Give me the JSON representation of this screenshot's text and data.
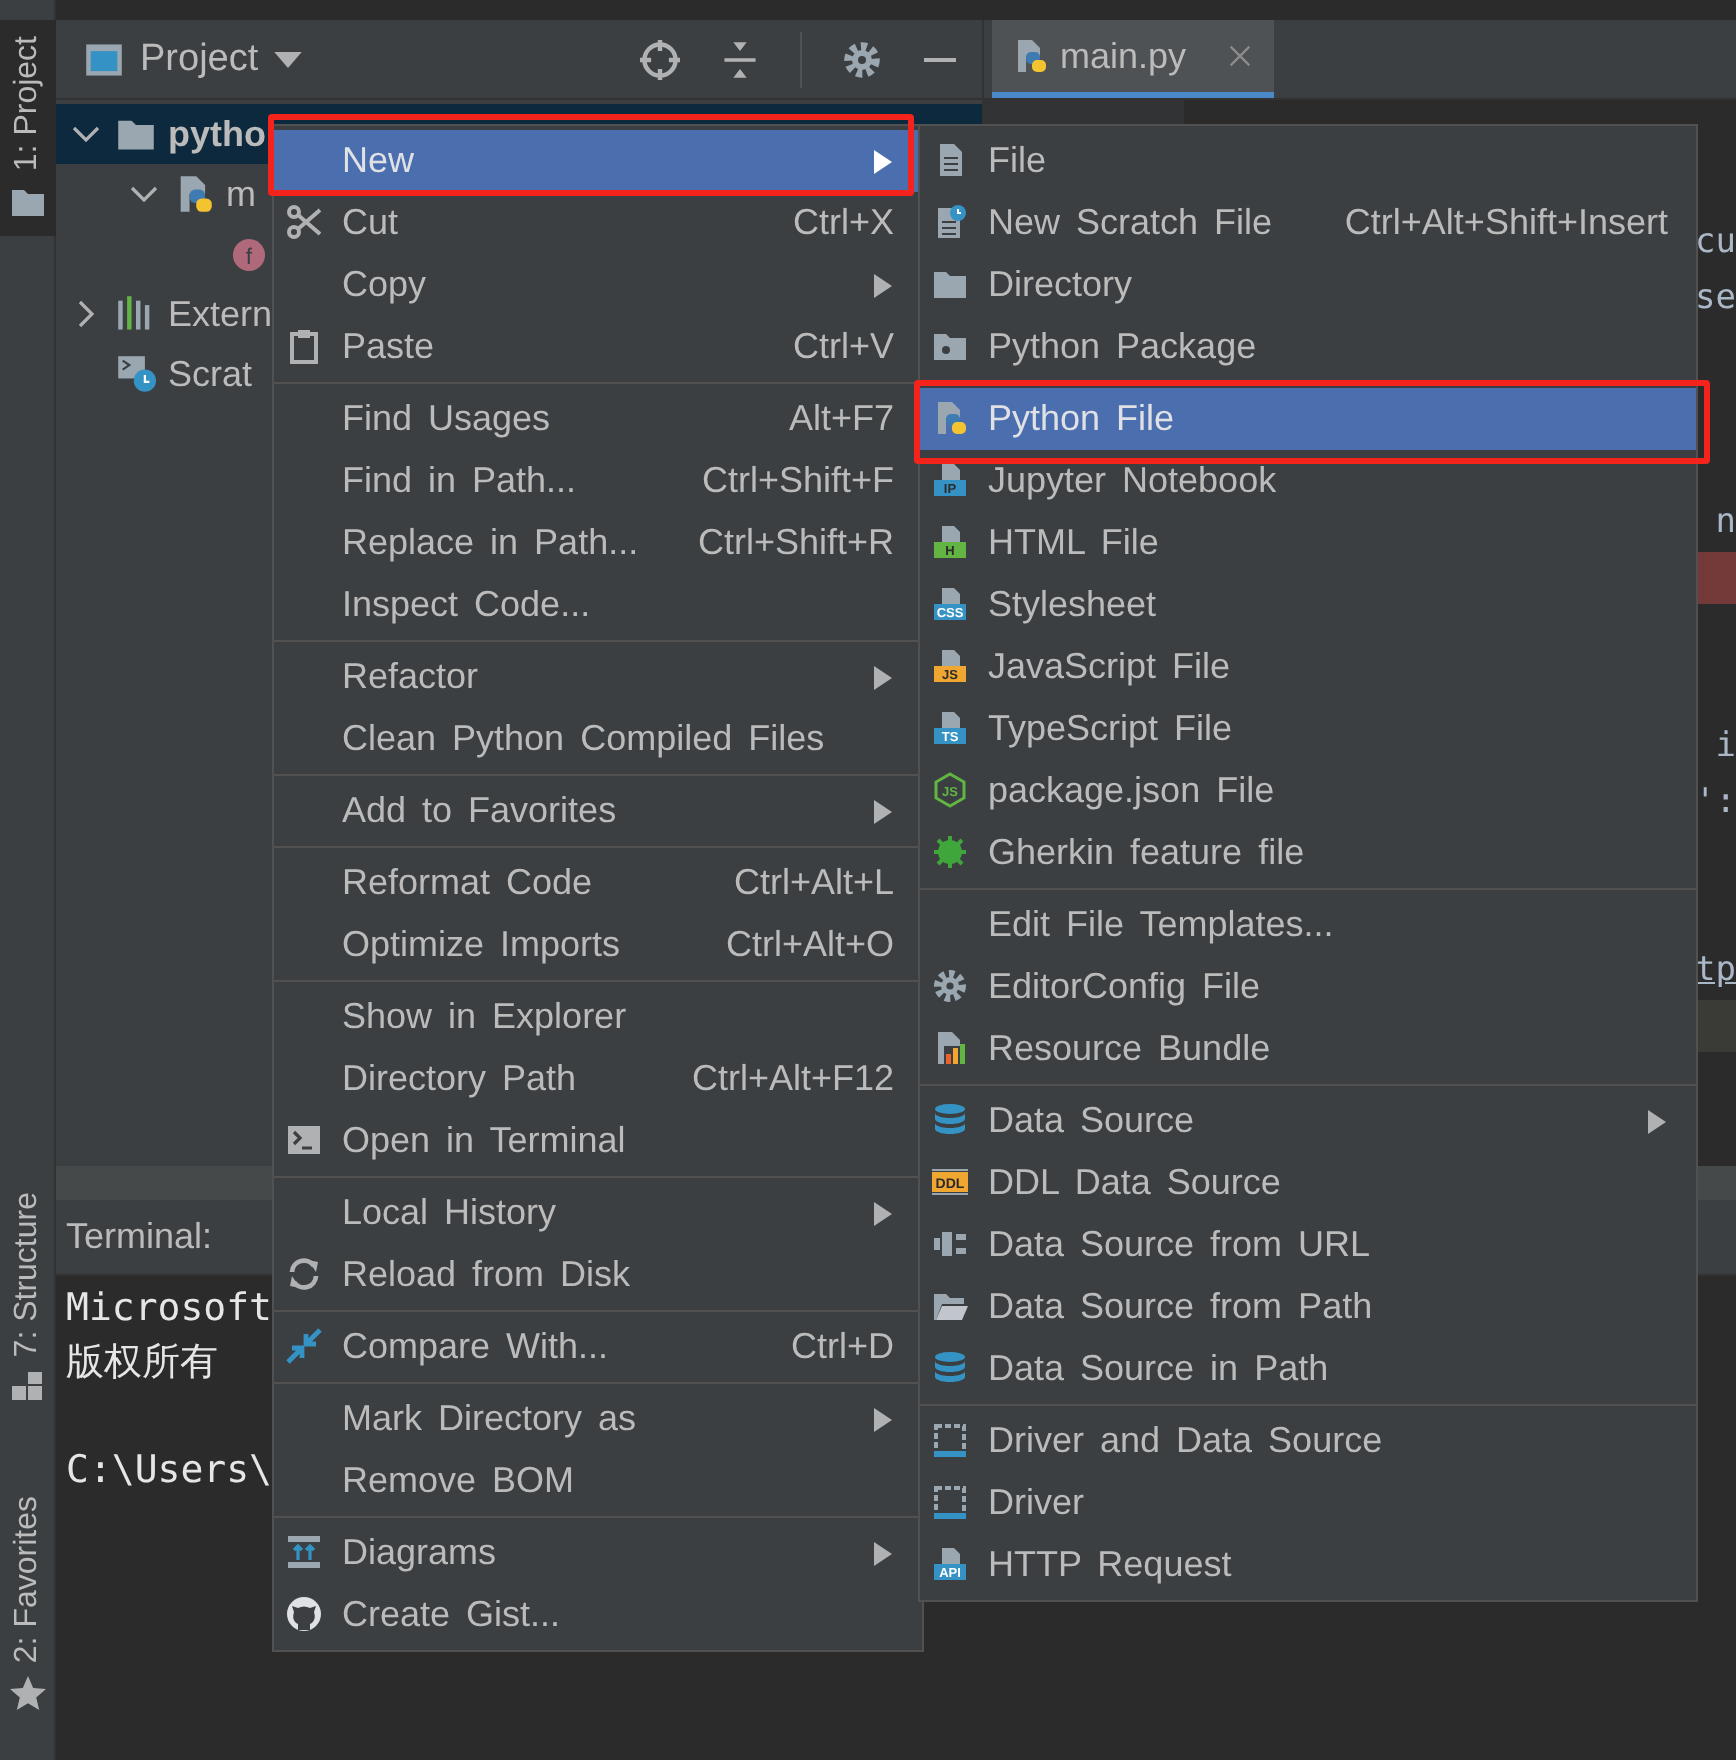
{
  "tool_strip": [
    {
      "label": "1: Project",
      "kind": "folder",
      "selected": true
    },
    {
      "label": "7: Structure",
      "kind": "structure",
      "selected": false
    },
    {
      "label": "2: Favorites",
      "kind": "star",
      "selected": false
    }
  ],
  "project_panel": {
    "title": "Project",
    "tree": [
      {
        "label": "pytho",
        "kind": "folder",
        "expanded": true,
        "selected": true,
        "children": [
          {
            "label": "m",
            "kind": "python",
            "expanded": true,
            "selected": false,
            "children": [
              {
                "kind": "function",
                "badge": "f",
                "selected": false
              }
            ]
          }
        ]
      },
      {
        "label": "Extern",
        "kind": "library",
        "expanded": false,
        "selected": false
      },
      {
        "label": "Scrat",
        "kind": "scratches",
        "selected": false
      }
    ]
  },
  "editor": {
    "tabs": [
      {
        "label": "main.py",
        "selected": true
      }
    ],
    "lines": [
      {
        "text": "cu",
        "kind": "code"
      },
      {
        "text": "se",
        "kind": "code"
      },
      {
        "text": "n",
        "kind": "code"
      },
      {
        "kind": "error"
      },
      {
        "text": "i",
        "kind": "code"
      },
      {
        "text": "':",
        "kind": "code"
      },
      {
        "text": "tp",
        "kind": "code",
        "underlined": true
      },
      {
        "kind": "current"
      }
    ]
  },
  "terminal": {
    "title": "Terminal:",
    "lines": [
      {
        "text": "Microsoft"
      },
      {
        "text": "版权所有"
      },
      {
        "text": "C:\\Users\\"
      }
    ]
  },
  "context_menu": {
    "groups": [
      [
        {
          "label": "New",
          "submenu": true,
          "selected": true,
          "annotated": true
        },
        {
          "label": "Cut",
          "shortcut": "Ctrl+X",
          "submenu": false,
          "selected": false,
          "annotated": false
        },
        {
          "label": "Copy",
          "submenu": true,
          "selected": false,
          "annotated": false
        },
        {
          "label": "Paste",
          "shortcut": "Ctrl+V",
          "submenu": false,
          "selected": false,
          "annotated": false
        }
      ],
      [
        {
          "label": "Find Usages",
          "shortcut": "Alt+F7",
          "submenu": false,
          "selected": false,
          "annotated": false
        },
        {
          "label": "Find in Path...",
          "shortcut": "Ctrl+Shift+F",
          "submenu": false,
          "selected": false,
          "annotated": false
        },
        {
          "label": "Replace in Path...",
          "shortcut": "Ctrl+Shift+R",
          "submenu": false,
          "selected": false,
          "annotated": false
        },
        {
          "label": "Inspect Code...",
          "submenu": false,
          "selected": false,
          "annotated": false
        }
      ],
      [
        {
          "label": "Refactor",
          "submenu": true,
          "selected": false,
          "annotated": false
        },
        {
          "label": "Clean Python Compiled Files",
          "submenu": false,
          "selected": false,
          "annotated": false
        }
      ],
      [
        {
          "label": "Add to Favorites",
          "submenu": true,
          "selected": false,
          "annotated": false
        }
      ],
      [
        {
          "label": "Reformat Code",
          "shortcut": "Ctrl+Alt+L",
          "submenu": false,
          "selected": false,
          "annotated": false
        },
        {
          "label": "Optimize Imports",
          "shortcut": "Ctrl+Alt+O",
          "submenu": false,
          "selected": false,
          "annotated": false
        }
      ],
      [
        {
          "label": "Show in Explorer",
          "submenu": false,
          "selected": false,
          "annotated": false
        },
        {
          "label": "Directory Path",
          "shortcut": "Ctrl+Alt+F12",
          "submenu": false,
          "selected": false,
          "annotated": false
        },
        {
          "label": "Open in Terminal",
          "submenu": false,
          "selected": false,
          "annotated": false
        }
      ],
      [
        {
          "label": "Local History",
          "submenu": true,
          "selected": false,
          "annotated": false
        },
        {
          "label": "Reload from Disk",
          "submenu": false,
          "selected": false,
          "annotated": false
        }
      ],
      [
        {
          "label": "Compare With...",
          "shortcut": "Ctrl+D",
          "submenu": false,
          "selected": false,
          "annotated": false
        }
      ],
      [
        {
          "label": "Mark Directory as",
          "submenu": true,
          "selected": false,
          "annotated": false
        },
        {
          "label": "Remove BOM",
          "submenu": false,
          "selected": false,
          "annotated": false
        }
      ],
      [
        {
          "label": "Diagrams",
          "submenu": true,
          "selected": false,
          "annotated": false
        },
        {
          "label": "Create Gist...",
          "submenu": false,
          "selected": false,
          "annotated": false
        }
      ]
    ]
  },
  "new_submenu": {
    "groups": [
      [
        {
          "label": "File",
          "submenu": false,
          "selected": false,
          "annotated": false
        },
        {
          "label": "New Scratch File",
          "shortcut": "Ctrl+Alt+Shift+Insert",
          "submenu": false,
          "selected": false,
          "annotated": false
        },
        {
          "label": "Directory",
          "submenu": false,
          "selected": false,
          "annotated": false
        },
        {
          "label": "Python Package",
          "submenu": false,
          "selected": false,
          "annotated": false
        }
      ],
      [
        {
          "label": "Python File",
          "submenu": false,
          "selected": true,
          "annotated": true
        },
        {
          "label": "Jupyter Notebook",
          "badge": "IP",
          "submenu": false,
          "selected": false,
          "annotated": false
        },
        {
          "label": "HTML File",
          "badge": "H",
          "submenu": false,
          "selected": false,
          "annotated": false
        },
        {
          "label": "Stylesheet",
          "badge": "CSS",
          "submenu": false,
          "selected": false,
          "annotated": false
        },
        {
          "label": "JavaScript File",
          "badge": "JS",
          "submenu": false,
          "selected": false,
          "annotated": false
        },
        {
          "label": "TypeScript File",
          "badge": "TS",
          "submenu": false,
          "selected": false,
          "annotated": false
        },
        {
          "label": "package.json File",
          "badge": "JS",
          "submenu": false,
          "selected": false,
          "annotated": false
        },
        {
          "label": "Gherkin feature file",
          "submenu": false,
          "selected": false,
          "annotated": false
        }
      ],
      [
        {
          "label": "Edit File Templates...",
          "submenu": false,
          "selected": false,
          "annotated": false
        },
        {
          "label": "EditorConfig File",
          "submenu": false,
          "selected": false,
          "annotated": false
        },
        {
          "label": "Resource Bundle",
          "submenu": false,
          "selected": false,
          "annotated": false
        }
      ],
      [
        {
          "label": "Data Source",
          "submenu": true,
          "selected": false,
          "annotated": false
        },
        {
          "label": "DDL Data Source",
          "badge": "DDL",
          "submenu": false,
          "selected": false,
          "annotated": false
        },
        {
          "label": "Data Source from URL",
          "submenu": false,
          "selected": false,
          "annotated": false
        },
        {
          "label": "Data Source from Path",
          "submenu": false,
          "selected": false,
          "annotated": false
        },
        {
          "label": "Data Source in Path",
          "submenu": false,
          "selected": false,
          "annotated": false
        }
      ],
      [
        {
          "label": "Driver and Data Source",
          "submenu": false,
          "selected": false,
          "annotated": false
        },
        {
          "label": "Driver",
          "submenu": false,
          "selected": false,
          "annotated": false
        },
        {
          "label": "HTTP Request",
          "badge": "API",
          "submenu": false,
          "selected": false,
          "annotated": false
        }
      ]
    ]
  }
}
